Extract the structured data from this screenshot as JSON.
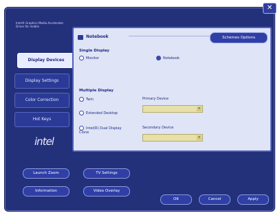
{
  "window": {
    "close_label": "✕",
    "header_text": "Intel® Graphics Media Accelerator Driver for mobile"
  },
  "sidebar": {
    "items": [
      {
        "label": "Display Devices"
      },
      {
        "label": "Display Settings"
      },
      {
        "label": "Color Correction"
      },
      {
        "label": "Hot Keys"
      }
    ],
    "logo_text": "intel"
  },
  "panel": {
    "device_name": "Notebook",
    "schemes_button": "Schemes Options",
    "single_display": {
      "title": "Single Display",
      "options": [
        "Monitor",
        "Notebook"
      ]
    },
    "multiple_display": {
      "title": "Multiple Display",
      "options": [
        "Twin",
        "Extended Desktop",
        "Intel(R) Dual Display Clone"
      ],
      "primary_label": "Primary Device",
      "secondary_label": "Secondary Device"
    }
  },
  "bottom": {
    "buttons": [
      "Launch Zoom",
      "TV Settings",
      "Information",
      "Video Overlay"
    ],
    "dialog_buttons": [
      "OK",
      "Cancel",
      "Apply"
    ]
  },
  "colors": {
    "window_bg": "#23307a",
    "panel_bg": "#dfe4f6",
    "accent": "#2f3fa6"
  }
}
